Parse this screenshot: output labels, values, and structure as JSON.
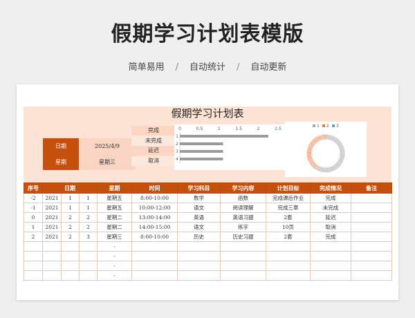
{
  "header": {
    "title": "假期学习计划表模版",
    "tags": [
      "简单易用",
      "自动统计",
      "自动更新"
    ]
  },
  "sheet": {
    "title": "假期学习计划表",
    "info": {
      "date_label": "日期",
      "date_value": "2025/4/9",
      "weekday_label": "星期",
      "weekday_value": "星期三"
    },
    "status_items": [
      "完成",
      "未完成",
      "延迟",
      "取消"
    ]
  },
  "chart_data": [
    {
      "type": "bar",
      "orientation": "horizontal",
      "categories": [
        "1",
        "2",
        "3",
        "4"
      ],
      "values": [
        2.25,
        1.1,
        1.1,
        1.1
      ],
      "xlim": [
        0,
        2.5
      ],
      "xticks": [
        "0",
        "0.5",
        "1",
        "1.5",
        "2",
        "2.5"
      ],
      "color": "#9a9a9a"
    },
    {
      "type": "pie",
      "variant": "donut",
      "legend": [
        "1",
        "2",
        "3"
      ],
      "legend_colors": [
        "#a6a6a6",
        "#ed7d31",
        "#5b9bd5"
      ],
      "values": [
        60,
        40,
        0
      ],
      "colors": [
        "#bdbdbd",
        "#f4a37a",
        "#5b9bd5"
      ]
    }
  ],
  "table": {
    "headers": [
      "序号",
      "日期",
      "星期",
      "时间",
      "学习科目",
      "学习内容",
      "计划目标",
      "完成情况",
      "备注"
    ],
    "rows": [
      [
        "-2",
        "2021",
        "1",
        "1",
        "星期五",
        "8:00-10:00",
        "数学",
        "函数",
        "完成课后作业",
        "完成",
        ""
      ],
      [
        "-1",
        "2021",
        "1",
        "1",
        "星期五",
        "10:00-12:00",
        "语文",
        "阅读理解",
        "完成三章",
        "未完成",
        ""
      ],
      [
        "0",
        "2021",
        "2",
        "2",
        "星期二",
        "13:00-14:00",
        "英语",
        "英语习题",
        "2套",
        "延迟",
        ""
      ],
      [
        "1",
        "2021",
        "2",
        "2",
        "星期二",
        "14:00-15:00",
        "语文",
        "练字",
        "10页",
        "取消",
        ""
      ],
      [
        "2",
        "2021",
        "2",
        "3",
        "星期三",
        "8:00-10:00",
        "历史",
        "历史习题",
        "2套",
        "完成",
        ""
      ],
      [
        "",
        "",
        "",
        "",
        "-",
        "",
        "",
        "",
        "",
        "",
        ""
      ],
      [
        "",
        "",
        "",
        "",
        "-",
        "",
        "",
        "",
        "",
        "",
        ""
      ],
      [
        "",
        "",
        "",
        "",
        "-",
        "",
        "",
        "",
        "",
        "",
        ""
      ],
      [
        "",
        "",
        "",
        "",
        "-",
        "",
        "",
        "",
        "",
        "",
        ""
      ]
    ]
  }
}
